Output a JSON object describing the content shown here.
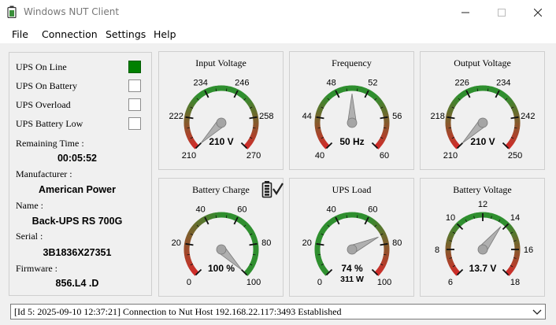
{
  "window": {
    "title": "Windows NUT Client"
  },
  "menu": [
    "File",
    "Connection",
    "Settings",
    "Help"
  ],
  "status": [
    {
      "label": "UPS On Line",
      "checked": true
    },
    {
      "label": "UPS On Battery",
      "checked": false
    },
    {
      "label": "UPS Overload",
      "checked": false
    },
    {
      "label": "UPS Battery Low",
      "checked": false
    }
  ],
  "info": {
    "remaining_time_label": "Remaining Time :",
    "remaining_time": "00:05:52",
    "manufacturer_label": "Manufacturer :",
    "manufacturer": "American Power",
    "name_label": "Name :",
    "name": "Back-UPS RS 700G",
    "serial_label": "Serial :",
    "serial": "3B1836X27351",
    "firmware_label": "Firmware :",
    "firmware": "856.L4 .D"
  },
  "gauges": [
    {
      "title": "Input Voltage",
      "min": 210,
      "max": 270,
      "ticks": [
        210,
        222,
        234,
        246,
        258,
        270
      ],
      "value": 210,
      "readout": "210 V",
      "sub": "",
      "scheme": "voltage",
      "icon": ""
    },
    {
      "title": "Frequency",
      "min": 40,
      "max": 60,
      "ticks": [
        40,
        44,
        48,
        52,
        56,
        60
      ],
      "value": 50,
      "readout": "50 Hz",
      "sub": "",
      "scheme": "voltage",
      "icon": ""
    },
    {
      "title": "Output Voltage",
      "min": 210,
      "max": 250,
      "ticks": [
        210,
        218,
        226,
        234,
        242,
        250
      ],
      "value": 210,
      "readout": "210 V",
      "sub": "",
      "scheme": "voltage",
      "icon": ""
    },
    {
      "title": "Battery Charge",
      "min": 0,
      "max": 100,
      "ticks": [
        0,
        20,
        40,
        60,
        80,
        100
      ],
      "value": 100,
      "readout": "100 %",
      "sub": "",
      "scheme": "charge",
      "icon": "battery-check-icon"
    },
    {
      "title": "UPS Load",
      "min": 0,
      "max": 100,
      "ticks": [
        0,
        20,
        40,
        60,
        80,
        100
      ],
      "value": 74,
      "readout": "74 %",
      "sub": "311 W",
      "scheme": "load",
      "icon": ""
    },
    {
      "title": "Battery Voltage",
      "min": 6,
      "max": 18,
      "ticks": [
        6,
        8,
        10,
        12,
        14,
        16,
        18
      ],
      "value": 13.7,
      "readout": "13.7 V",
      "sub": "",
      "scheme": "battery",
      "icon": ""
    }
  ],
  "colors": {
    "green": "#2f8f2f",
    "red": "#d42a2a",
    "online": "#008000"
  },
  "statusbar": {
    "message": "[Id 5: 2025-09-10 12:37:21] Connection to Nut Host 192.168.22.117:3493 Established"
  }
}
